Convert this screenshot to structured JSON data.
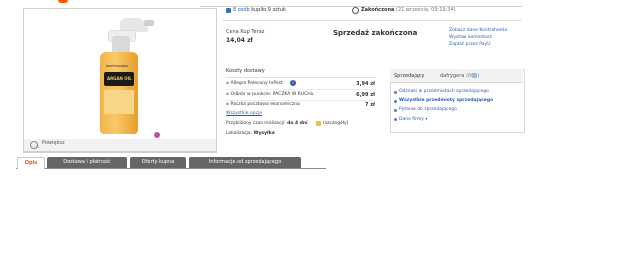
{
  "product": {
    "zoom_label": "Powiększ",
    "bottle_brand": "PROFESSIONAL",
    "bottle_label": "ARGAN OIL",
    "bottle_logo": "bioclaret"
  },
  "auction": {
    "buyers_link": "8 osób",
    "buyers_text": "kupiło 9 sztuk",
    "ended_label": "Zakończona",
    "ended_date": "(21 września, 09:19:34)",
    "price_label": "Cena Kup Teraz",
    "price_value": "14,04 zł",
    "status": "Sprzedaż zakończona",
    "side_links": [
      "Zobacz dane Kontrahenta",
      "Wystaw komentarz",
      "Zapłać przez PayU"
    ]
  },
  "shipping": {
    "title": "Koszty dostawy",
    "rows": [
      {
        "label": "Allegro Polecony InPost",
        "value": "3,94 zł"
      },
      {
        "label": "Odbiór w punkcie: PACZKA W RUCHu",
        "value": "6,99 zł"
      },
      {
        "label": "Paczka pocztowa ekonomiczna",
        "value": "7 zł"
      }
    ],
    "all_options": "Wszystkie opcje",
    "realization_label": "Przybliżony czas realizacji:",
    "realization_value": "do 4 dni",
    "details_link": "(szczegóły)",
    "location_label": "Lokalizacja:",
    "location_value": "Wysyłka"
  },
  "seller": {
    "title": "Sprzedający",
    "name": "dafrygera",
    "rating": "(601)",
    "items": [
      "Odznaki w przedmiotach sprzedającego",
      "Wszystkie przedmioty sprzedającego",
      "Pytanie do sprzedającego",
      "Dane firmy"
    ]
  },
  "tabs": [
    "Opis",
    "Dostawa i płatność",
    "Oferty kupna",
    "Informacje od sprzedającego"
  ]
}
